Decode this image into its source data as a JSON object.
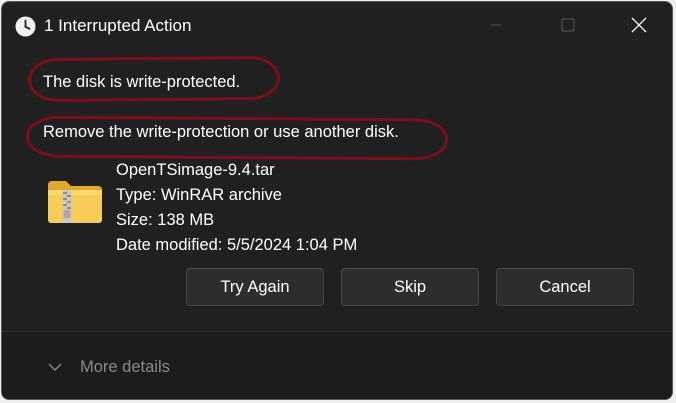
{
  "window": {
    "title": "1 Interrupted Action",
    "icon": "clock-icon",
    "controls": {
      "minimize": "minimize-icon",
      "maximize": "maximize-icon",
      "close": "close-icon"
    }
  },
  "message": {
    "error": "The disk is write-protected.",
    "instruction": "Remove the write-protection or use another disk."
  },
  "file": {
    "icon": "zip-folder-icon",
    "name": "OpenTSimage-9.4.tar",
    "type": "Type: WinRAR archive",
    "size": "Size: 138 MB",
    "date_modified": "Date modified: 5/5/2024 1:04 PM"
  },
  "buttons": {
    "try_again": "Try Again",
    "skip": "Skip",
    "cancel": "Cancel"
  },
  "footer": {
    "more_details": "More details",
    "icon": "chevron-down-icon"
  },
  "colors": {
    "background": "#202020",
    "annotation": "#7a0f18",
    "button": "#2d2d2d",
    "muted_text": "#8a8a8a"
  }
}
